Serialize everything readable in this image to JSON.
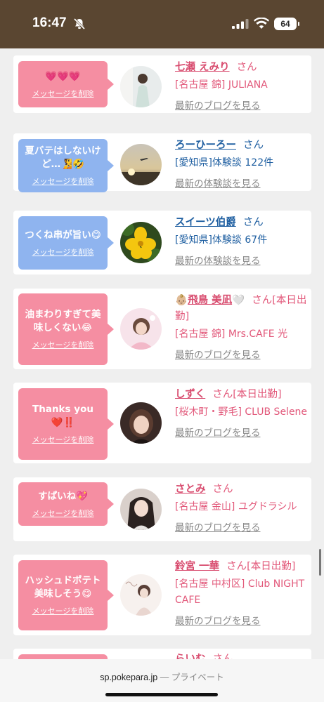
{
  "status_bar": {
    "time": "16:47",
    "battery": "64"
  },
  "cards": [
    {
      "message": "💗💗💗",
      "delete_label": "メッセージを削除",
      "bubble_color": "pink",
      "avatar": "avatar-woman-white-dress",
      "name_prefix": "",
      "name": "七瀬 えみり",
      "name_suffix": "",
      "honorific": "さん",
      "work_status": "",
      "shop": "[名古屋 錦] JULIANA",
      "link": "最新のブログを見る",
      "kind": "girl"
    },
    {
      "message": "夏バテはしないけど…🧏🤣",
      "delete_label": "メッセージを削除",
      "bubble_color": "blue",
      "avatar": "avatar-sunset-airplane",
      "name_prefix": "",
      "name": "ろーひーろー",
      "name_suffix": "",
      "honorific": "さん",
      "work_status": "",
      "shop": "[愛知県]体験談 122件",
      "link": "最新の体験談を見る",
      "kind": "user"
    },
    {
      "message": "つくね串が旨い😋",
      "delete_label": "メッセージを削除",
      "bubble_color": "blue",
      "avatar": "avatar-yellow-flower",
      "name_prefix": "",
      "name": "スイーツ伯爵",
      "name_suffix": "",
      "honorific": "さん",
      "work_status": "",
      "shop": "[愛知県]体験談 67件",
      "link": "最新の体験談を見る",
      "kind": "user"
    },
    {
      "message": "油まわりすぎて美味しくない😂",
      "delete_label": "メッセージを削除",
      "bubble_color": "pink",
      "avatar": "avatar-woman-pink",
      "name_prefix": "👶🏼",
      "name": "飛鳥 美凪",
      "name_suffix": "🤍",
      "honorific": "さん",
      "work_status": "[本日出勤]",
      "shop": "[名古屋 錦] Mrs.CAFE 光",
      "link": "最新のブログを見る",
      "kind": "girl"
    },
    {
      "message": "Thanks you❤️‼️",
      "delete_label": "メッセージを削除",
      "bubble_color": "pink",
      "avatar": "avatar-woman-dark",
      "name_prefix": "",
      "name": "しずく",
      "name_suffix": "",
      "honorific": "さん",
      "work_status": "[本日出勤]",
      "shop": "[桜木町・野毛] CLUB Selene",
      "link": "最新のブログを見る",
      "kind": "girl"
    },
    {
      "message": "すぱいね💖",
      "delete_label": "メッセージを削除",
      "bubble_color": "pink",
      "avatar": "avatar-woman-longhair",
      "name_prefix": "",
      "name": "さとみ",
      "name_suffix": "",
      "honorific": "さん",
      "work_status": "",
      "shop": "[名古屋 金山] ユグドラシル",
      "link": "最新のブログを見る",
      "kind": "girl"
    },
    {
      "message": "ハッシュドポテト美味しそう😋",
      "delete_label": "メッセージを削除",
      "bubble_color": "pink",
      "avatar": "avatar-woman-sketch",
      "name_prefix": "",
      "name": "鈴宮 一華",
      "name_suffix": "",
      "honorific": "さん",
      "work_status": "[本日出勤]",
      "shop": "[名古屋 中村区] Club NIGHT CAFE",
      "link": "最新のブログを見る",
      "kind": "girl"
    },
    {
      "message": "",
      "delete_label": "",
      "bubble_color": "pink",
      "avatar": "avatar-partial",
      "name_prefix": "",
      "name": "らいむ",
      "name_suffix": "",
      "honorific": "さん",
      "work_status": "",
      "shop": "",
      "link": "",
      "kind": "girl"
    }
  ],
  "browser": {
    "url": "sp.pokepara.jp",
    "separator": "—",
    "mode": "プライベート"
  }
}
